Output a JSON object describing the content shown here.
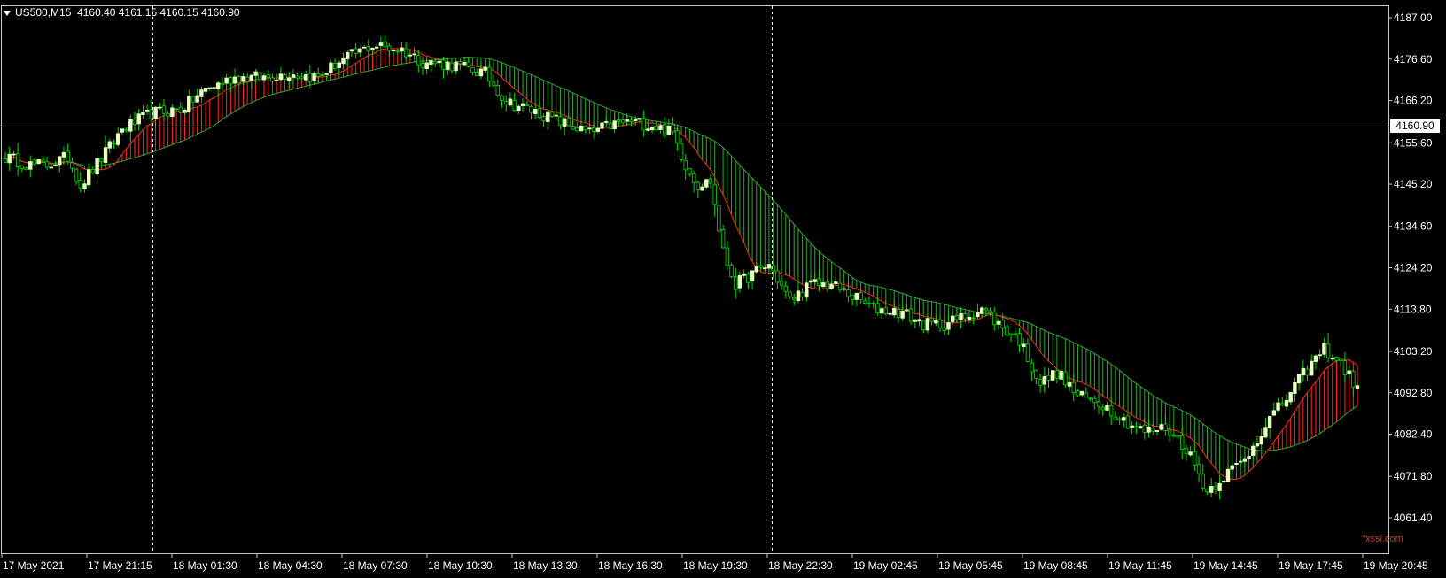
{
  "header": {
    "symbol": "US500,M15",
    "ohlc": "4160.40 4161.15 4160.15 4160.90"
  },
  "current_price_label": "4160.90",
  "watermark": "fxssi.com",
  "colors": {
    "background": "#000000",
    "bull_candle": "#eaffc0",
    "wick": "#00e000",
    "slow_line": "#2fa82f",
    "fast_line": "#ff2a1a",
    "cloud_bear": "#2fa82f",
    "cloud_bull": "#ff2a1a",
    "crosshair": "#ffffff"
  },
  "chart_data": {
    "type": "candlestick",
    "symbol": "US500",
    "timeframe": "M15",
    "y_axis": {
      "ticks": [
        "4187.00",
        "4176.60",
        "4166.20",
        "4155.60",
        "4145.20",
        "4134.60",
        "4124.20",
        "4113.80",
        "4103.20",
        "4092.80",
        "4082.40",
        "4071.80",
        "4061.40"
      ],
      "range": [
        4058.5,
        4188.7
      ]
    },
    "x_axis": {
      "ticks": [
        "17 May 2021",
        "17 May 21:15",
        "18 May 01:30",
        "18 May 04:30",
        "18 May 07:30",
        "18 May 10:30",
        "18 May 13:30",
        "18 May 16:30",
        "18 May 19:30",
        "18 May 22:30",
        "19 May 02:45",
        "19 May 05:45",
        "19 May 08:45",
        "19 May 11:45",
        "19 May 14:45",
        "19 May 17:45",
        "19 May 20:45"
      ]
    },
    "close_anchors": [
      [
        0,
        4152
      ],
      [
        6,
        4150
      ],
      [
        10,
        4150
      ],
      [
        15,
        4152
      ],
      [
        18,
        4145
      ],
      [
        24,
        4153
      ],
      [
        28,
        4159
      ],
      [
        35,
        4163
      ],
      [
        42,
        4164
      ],
      [
        48,
        4169
      ],
      [
        55,
        4172
      ],
      [
        62,
        4172
      ],
      [
        68,
        4173
      ],
      [
        75,
        4172
      ],
      [
        80,
        4176
      ],
      [
        88,
        4180
      ],
      [
        95,
        4179
      ],
      [
        100,
        4176
      ],
      [
        108,
        4175
      ],
      [
        115,
        4173
      ],
      [
        120,
        4166
      ],
      [
        128,
        4163
      ],
      [
        135,
        4160
      ],
      [
        140,
        4158
      ],
      [
        145,
        4160
      ],
      [
        150,
        4161
      ],
      [
        155,
        4160
      ],
      [
        160,
        4158
      ],
      [
        163,
        4150
      ],
      [
        166,
        4145
      ],
      [
        169,
        4146
      ],
      [
        172,
        4128
      ],
      [
        175,
        4120
      ],
      [
        178,
        4122
      ],
      [
        183,
        4125
      ],
      [
        188,
        4116
      ],
      [
        193,
        4120
      ],
      [
        198,
        4120
      ],
      [
        203,
        4117
      ],
      [
        208,
        4114
      ],
      [
        215,
        4113
      ],
      [
        220,
        4110
      ],
      [
        225,
        4110
      ],
      [
        230,
        4112
      ],
      [
        234,
        4114
      ],
      [
        238,
        4110
      ],
      [
        243,
        4106
      ],
      [
        248,
        4095
      ],
      [
        252,
        4098
      ],
      [
        257,
        4092
      ],
      [
        263,
        4090
      ],
      [
        268,
        4086
      ],
      [
        273,
        4083
      ],
      [
        278,
        4084
      ],
      [
        283,
        4079
      ],
      [
        288,
        4068
      ],
      [
        292,
        4072
      ],
      [
        297,
        4076
      ],
      [
        302,
        4085
      ],
      [
        306,
        4090
      ],
      [
        310,
        4096
      ],
      [
        313,
        4100
      ],
      [
        316,
        4104
      ],
      [
        320,
        4100
      ],
      [
        324,
        4094
      ]
    ],
    "fast_ma_period": 10,
    "slow_ma_period": 34,
    "crosshair_times": [
      "17 May 22:30",
      "19 May 00:15"
    ],
    "current_price": 4160.9
  }
}
